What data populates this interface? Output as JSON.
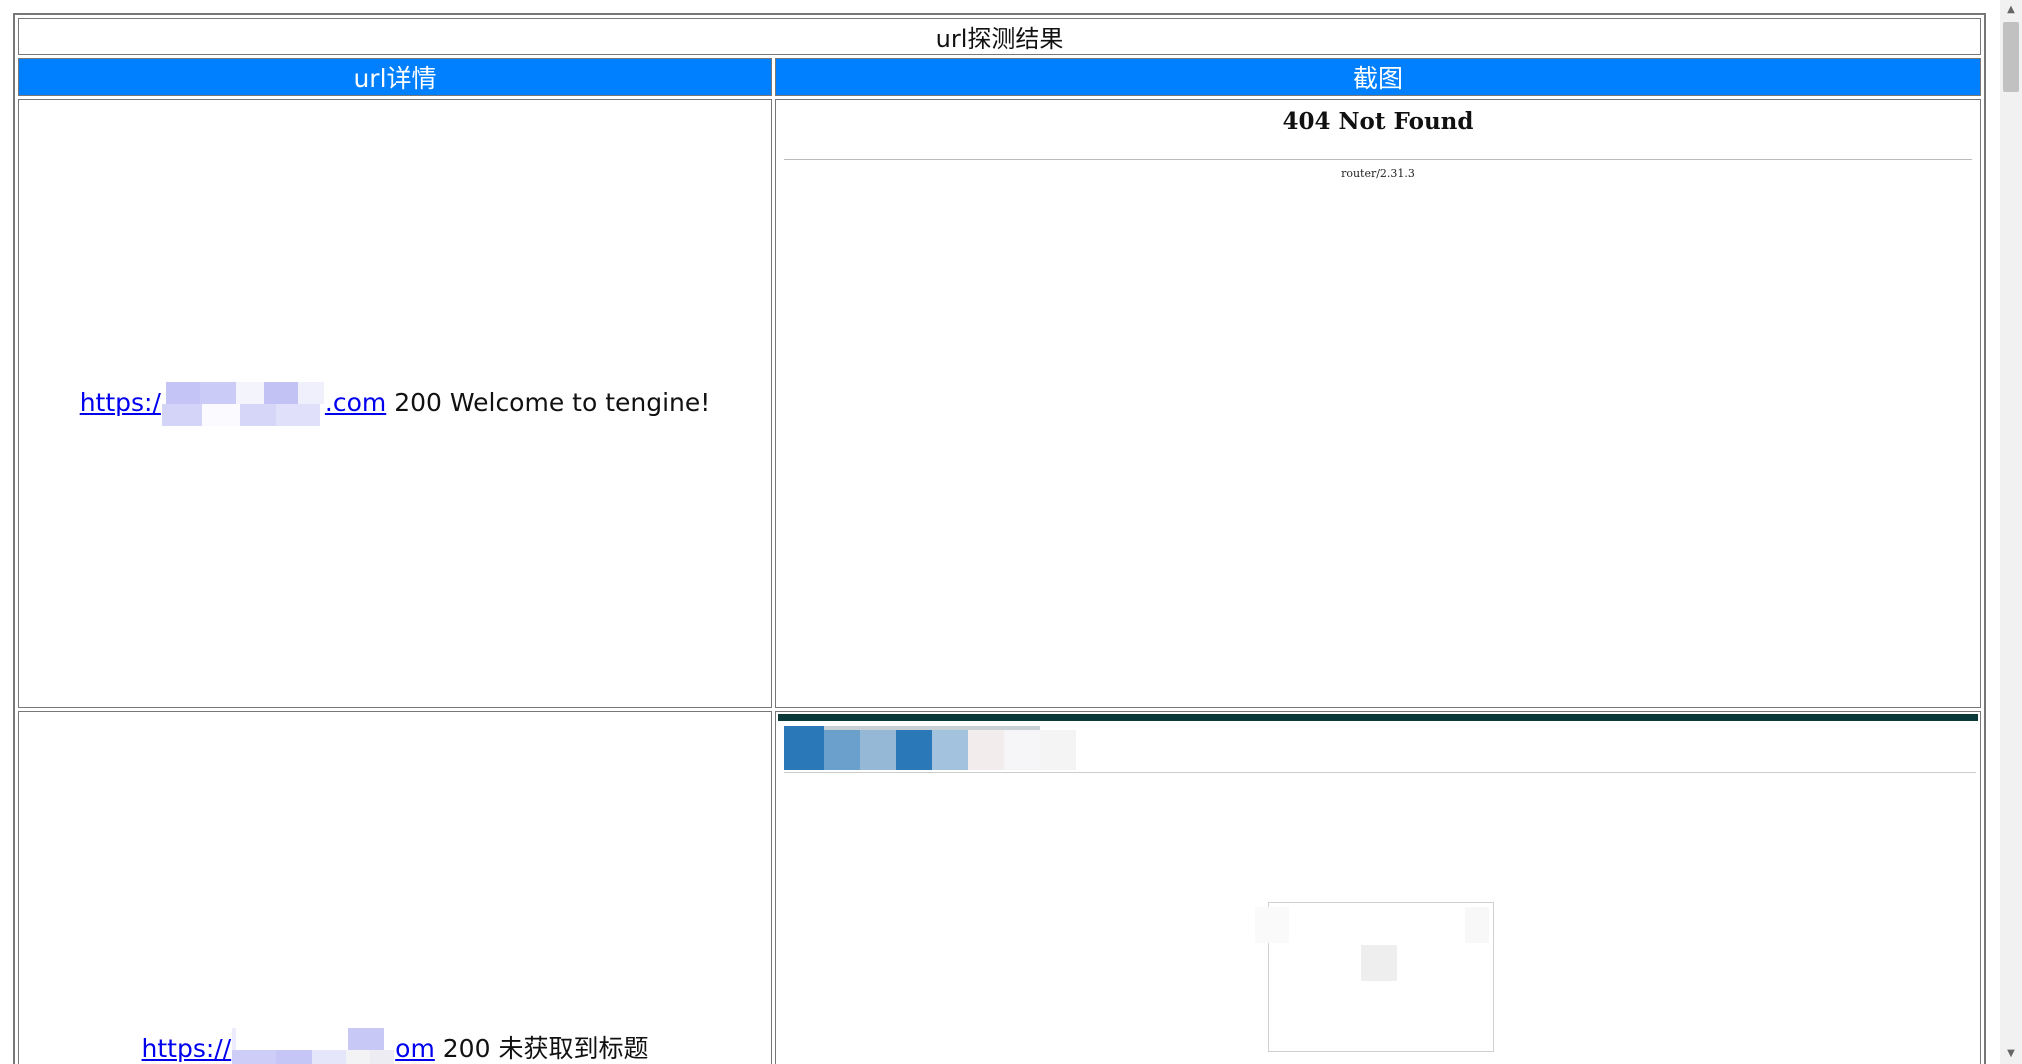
{
  "table": {
    "title": "url探测结果",
    "headers": {
      "detail": "url详情",
      "screenshot": "截图"
    },
    "rows": [
      {
        "link_prefix": "https:/",
        "link_suffix": ".com",
        "status": "200",
        "page_title": "Welcome to tengine!",
        "screenshot": {
          "heading": "404 Not Found",
          "server": "router/2.31.3"
        }
      },
      {
        "link_prefix": "https://",
        "link_suffix": "om",
        "status": "200",
        "page_title": "未获取到标题"
      }
    ]
  },
  "colors": {
    "header_bg": "#0080ff",
    "header_text": "#ffffff",
    "link": "#0000ee",
    "border": "#777777"
  },
  "scrollbar": {
    "up_icon": "triangle-up-icon",
    "down_icon": "triangle-down-icon"
  }
}
